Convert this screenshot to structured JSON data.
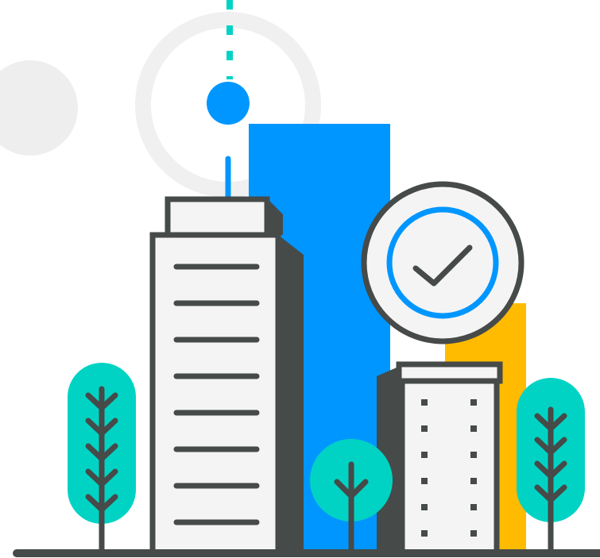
{
  "illustration": {
    "subject": "city-buildings-with-checkmark-badge",
    "colors": {
      "outline": "#464a48",
      "facade": "#f4f4f4",
      "blue": "#0096ff",
      "yellow": "#ffbb00",
      "teal": "#00d3c4",
      "soft_grey": "#eeeeee",
      "white": "#ffffff"
    },
    "icons": [
      "check-icon",
      "antenna",
      "tree"
    ]
  }
}
